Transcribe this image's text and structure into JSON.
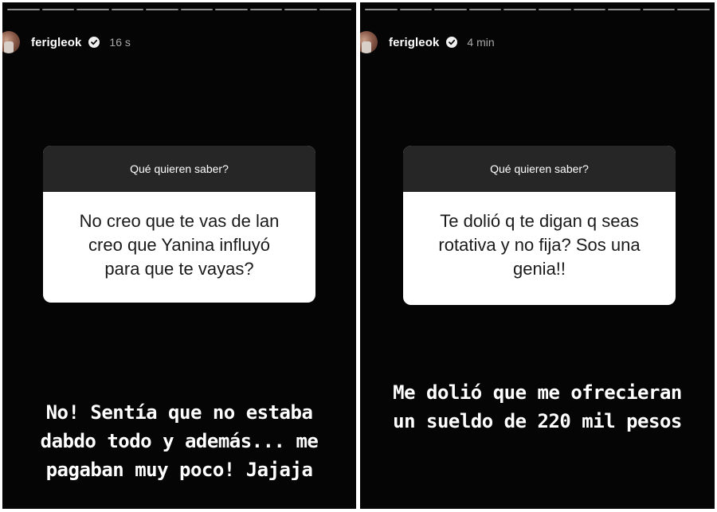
{
  "stories": [
    {
      "username": "ferigleok",
      "time": "16 s",
      "question_header": "Qué quieren saber?",
      "question_text": "No creo que te vas de lan\ncreo que Yanina influyó\npara que te vayas?",
      "answer_text": "No! Sentía que no estaba\ndabdo todo y además... me\npagaban muy poco! Jajaja"
    },
    {
      "username": "ferigleok",
      "time": "4 min",
      "question_header": "Qué quieren saber?",
      "question_text": "Te dolió q te digan q seas\nrotativa y no fija? Sos una\ngenia!!",
      "answer_text": "Me dolió que me ofrecieran\nun sueldo de 220 mil pesos"
    }
  ],
  "icons": {
    "verified": "verified-badge-icon",
    "avatar": "profile-avatar"
  },
  "colors": {
    "background": "#050505",
    "question_header_bg": "#262626",
    "question_body_bg": "#ffffff",
    "text_primary": "#ffffff",
    "text_secondary": "#a8a8a8"
  }
}
